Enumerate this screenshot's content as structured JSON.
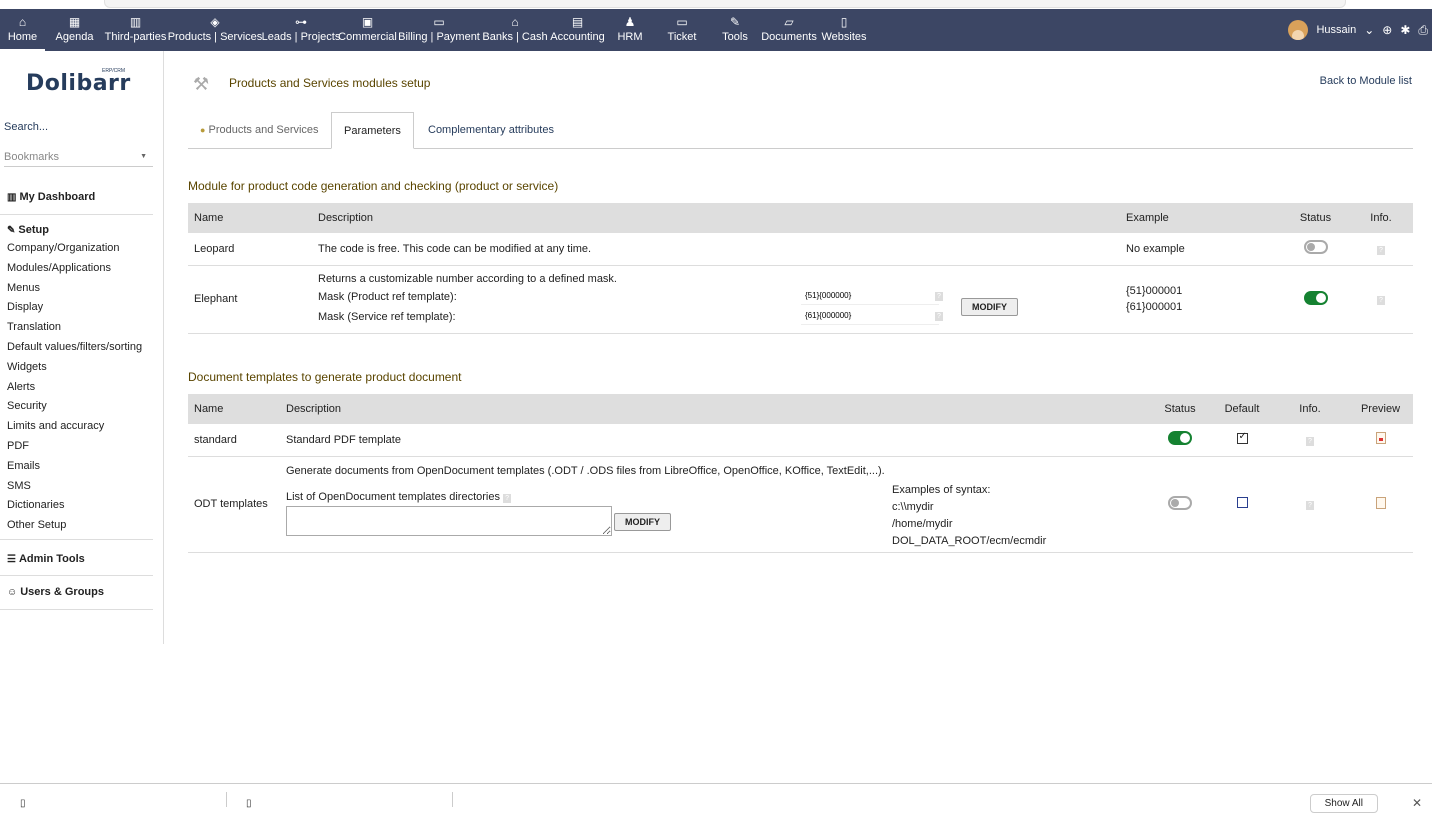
{
  "topnav": {
    "items": [
      {
        "label": "Home",
        "icon": "home-icon",
        "glyph": "⌂"
      },
      {
        "label": "Agenda",
        "icon": "calendar-icon",
        "glyph": "▦"
      },
      {
        "label": "Third-parties",
        "icon": "building-icon",
        "glyph": "▥"
      },
      {
        "label": "Products | Services",
        "icon": "cube-icon",
        "glyph": "◈"
      },
      {
        "label": "Leads | Projects",
        "icon": "sitemap-icon",
        "glyph": "⊶"
      },
      {
        "label": "Commercial",
        "icon": "suitcase-icon",
        "glyph": "▣"
      },
      {
        "label": "Billing | Payment",
        "icon": "money-bill-icon",
        "glyph": "▭"
      },
      {
        "label": "Banks | Cash",
        "icon": "bank-icon",
        "glyph": "⌂"
      },
      {
        "label": "Accounting",
        "icon": "money-check-icon",
        "glyph": "▤"
      },
      {
        "label": "HRM",
        "icon": "user-tie-icon",
        "glyph": "♟"
      },
      {
        "label": "Ticket",
        "icon": "ticket-icon",
        "glyph": "▭"
      },
      {
        "label": "Tools",
        "icon": "wrench-icon",
        "glyph": "✎"
      },
      {
        "label": "Documents",
        "icon": "folder-open-icon",
        "glyph": "▱"
      },
      {
        "label": "Websites",
        "icon": "file-icon",
        "glyph": "▯"
      }
    ],
    "user": "Hussain",
    "user_chevron": "⌄"
  },
  "sidebar": {
    "logo": "Dolibarr",
    "logo_sub": "ERP/CRM",
    "search": "Search...",
    "bookmarks": "Bookmarks",
    "my_dashboard": "My Dashboard",
    "setup": "Setup",
    "setup_items": [
      "Company/Organization",
      "Modules/Applications",
      "Menus",
      "Display",
      "Translation",
      "Default values/filters/sorting",
      "Widgets",
      "Alerts",
      "Security",
      "Limits and accuracy",
      "PDF",
      "Emails",
      "SMS",
      "Dictionaries",
      "Other Setup"
    ],
    "admin_tools": "Admin Tools",
    "users_groups": "Users & Groups"
  },
  "main": {
    "title": "Products and Services modules setup",
    "back_link": "Back to Module list",
    "tabs": [
      "Products and Services",
      "Parameters",
      "Complementary attributes"
    ],
    "active_tab": "Parameters",
    "section1_title": "Module for product code generation and checking (product or service)",
    "table1": {
      "headers": {
        "name": "Name",
        "description": "Description",
        "example": "Example",
        "status": "Status",
        "info": "Info."
      },
      "rows": [
        {
          "name": "Leopard",
          "description": "The code is free. This code can be modified at any time.",
          "example": "No example",
          "status": "off"
        },
        {
          "name": "Elephant",
          "description": "Returns a customizable number according to a defined mask.",
          "mask_product_label": "Mask (Product ref template):",
          "mask_product_value": "{51}{000000}",
          "mask_service_label": "Mask (Service ref template):",
          "mask_service_value": "{61}{000000}",
          "modify": "MODIFY",
          "example1": "{51}000001",
          "example2": "{61}000001",
          "status": "on"
        }
      ]
    },
    "section2_title": "Document templates to generate product document",
    "table2": {
      "headers": {
        "name": "Name",
        "description": "Description",
        "status": "Status",
        "default": "Default",
        "info": "Info.",
        "preview": "Preview"
      },
      "rows": [
        {
          "name": "standard",
          "description": "Standard PDF template",
          "status": "on",
          "default": "checked"
        },
        {
          "name": "ODT templates",
          "description": "Generate documents from OpenDocument templates (.ODT / .ODS files from LibreOffice, OpenOffice, KOffice, TextEdit,...).",
          "dirs_label": "List of OpenDocument templates directories",
          "modify": "MODIFY",
          "syntax_title": "Examples of syntax:",
          "syntax_lines": [
            "c:\\\\mydir",
            "/home/mydir",
            "DOL_DATA_ROOT/ecm/ecmdir"
          ],
          "status": "off",
          "default": "unchecked"
        }
      ]
    }
  },
  "download_bar": {
    "show_all": "Show All",
    "close": "✕"
  }
}
